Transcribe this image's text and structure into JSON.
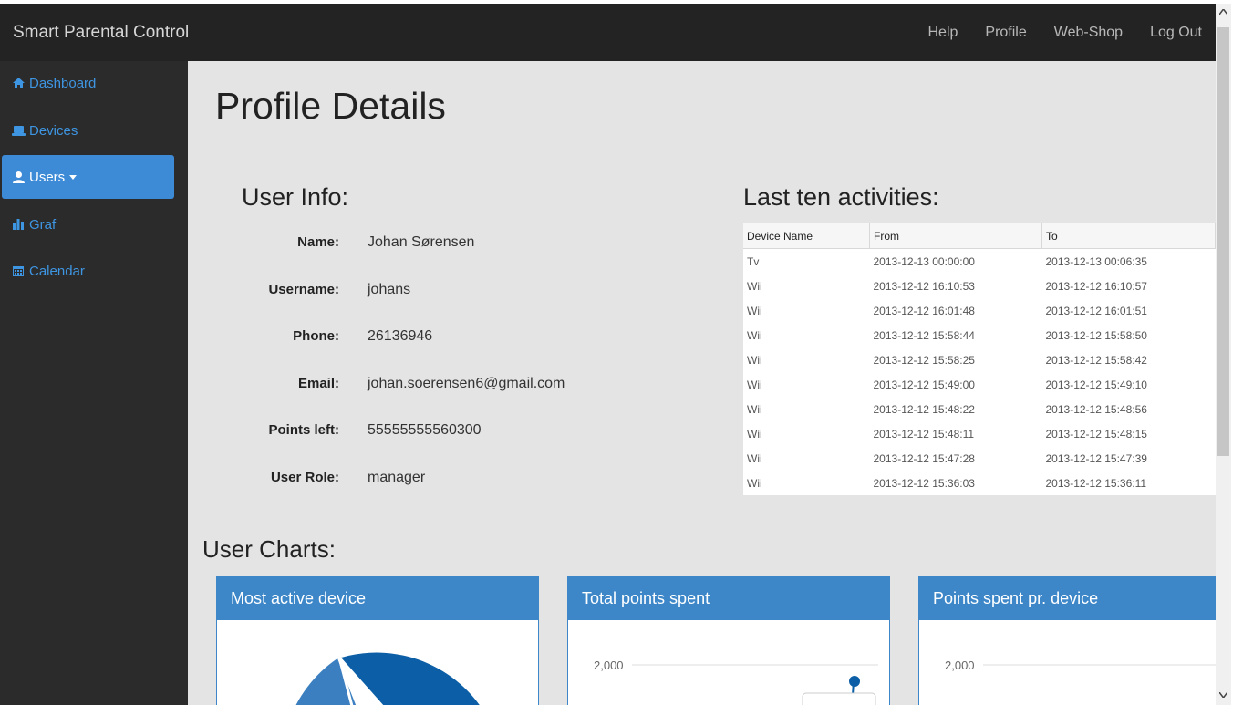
{
  "app": {
    "title": "Smart Parental Control"
  },
  "topnav": [
    "Help",
    "Profile",
    "Web-Shop",
    "Log Out"
  ],
  "sidebar": {
    "items": [
      {
        "label": "Dashboard",
        "icon": "home-icon"
      },
      {
        "label": "Devices",
        "icon": "laptop-icon"
      },
      {
        "label": "Users",
        "icon": "user-icon",
        "active": true
      },
      {
        "label": "Graf",
        "icon": "bar-chart-icon"
      },
      {
        "label": "Calendar",
        "icon": "calendar-icon"
      }
    ]
  },
  "page": {
    "title": "Profile Details"
  },
  "user_info": {
    "heading": "User Info:",
    "rows": [
      {
        "label": "Name:",
        "value": "Johan Sørensen"
      },
      {
        "label": "Username:",
        "value": "johans"
      },
      {
        "label": "Phone:",
        "value": "26136946"
      },
      {
        "label": "Email:",
        "value": "johan.soerensen6@gmail.com"
      },
      {
        "label": "Points left:",
        "value": "55555555560300"
      },
      {
        "label": "User Role:",
        "value": "manager"
      }
    ]
  },
  "activities": {
    "heading": "Last ten activities:",
    "columns": [
      "Device Name",
      "From",
      "To"
    ],
    "rows": [
      [
        "Tv",
        "2013-12-13 00:00:00",
        "2013-12-13 00:06:35"
      ],
      [
        "Wii",
        "2013-12-12 16:10:53",
        "2013-12-12 16:10:57"
      ],
      [
        "Wii",
        "2013-12-12 16:01:48",
        "2013-12-12 16:01:51"
      ],
      [
        "Wii",
        "2013-12-12 15:58:44",
        "2013-12-12 15:58:50"
      ],
      [
        "Wii",
        "2013-12-12 15:58:25",
        "2013-12-12 15:58:42"
      ],
      [
        "Wii",
        "2013-12-12 15:49:00",
        "2013-12-12 15:49:10"
      ],
      [
        "Wii",
        "2013-12-12 15:48:22",
        "2013-12-12 15:48:56"
      ],
      [
        "Wii",
        "2013-12-12 15:48:11",
        "2013-12-12 15:48:15"
      ],
      [
        "Wii",
        "2013-12-12 15:47:28",
        "2013-12-12 15:47:39"
      ],
      [
        "Wii",
        "2013-12-12 15:36:03",
        "2013-12-12 15:36:11"
      ]
    ]
  },
  "charts": {
    "heading": "User Charts:",
    "panels": [
      {
        "title": "Most active device"
      },
      {
        "title": "Total points spent",
        "y_tick": "2,000"
      },
      {
        "title": "Points spent pr. device",
        "y_tick": "2,000"
      }
    ]
  },
  "colors": {
    "topbar": "#232323",
    "sidebar": "#2b2b2b",
    "accent": "#3d87c9",
    "link": "#3e95e2",
    "content_bg": "#e4e4e4"
  }
}
